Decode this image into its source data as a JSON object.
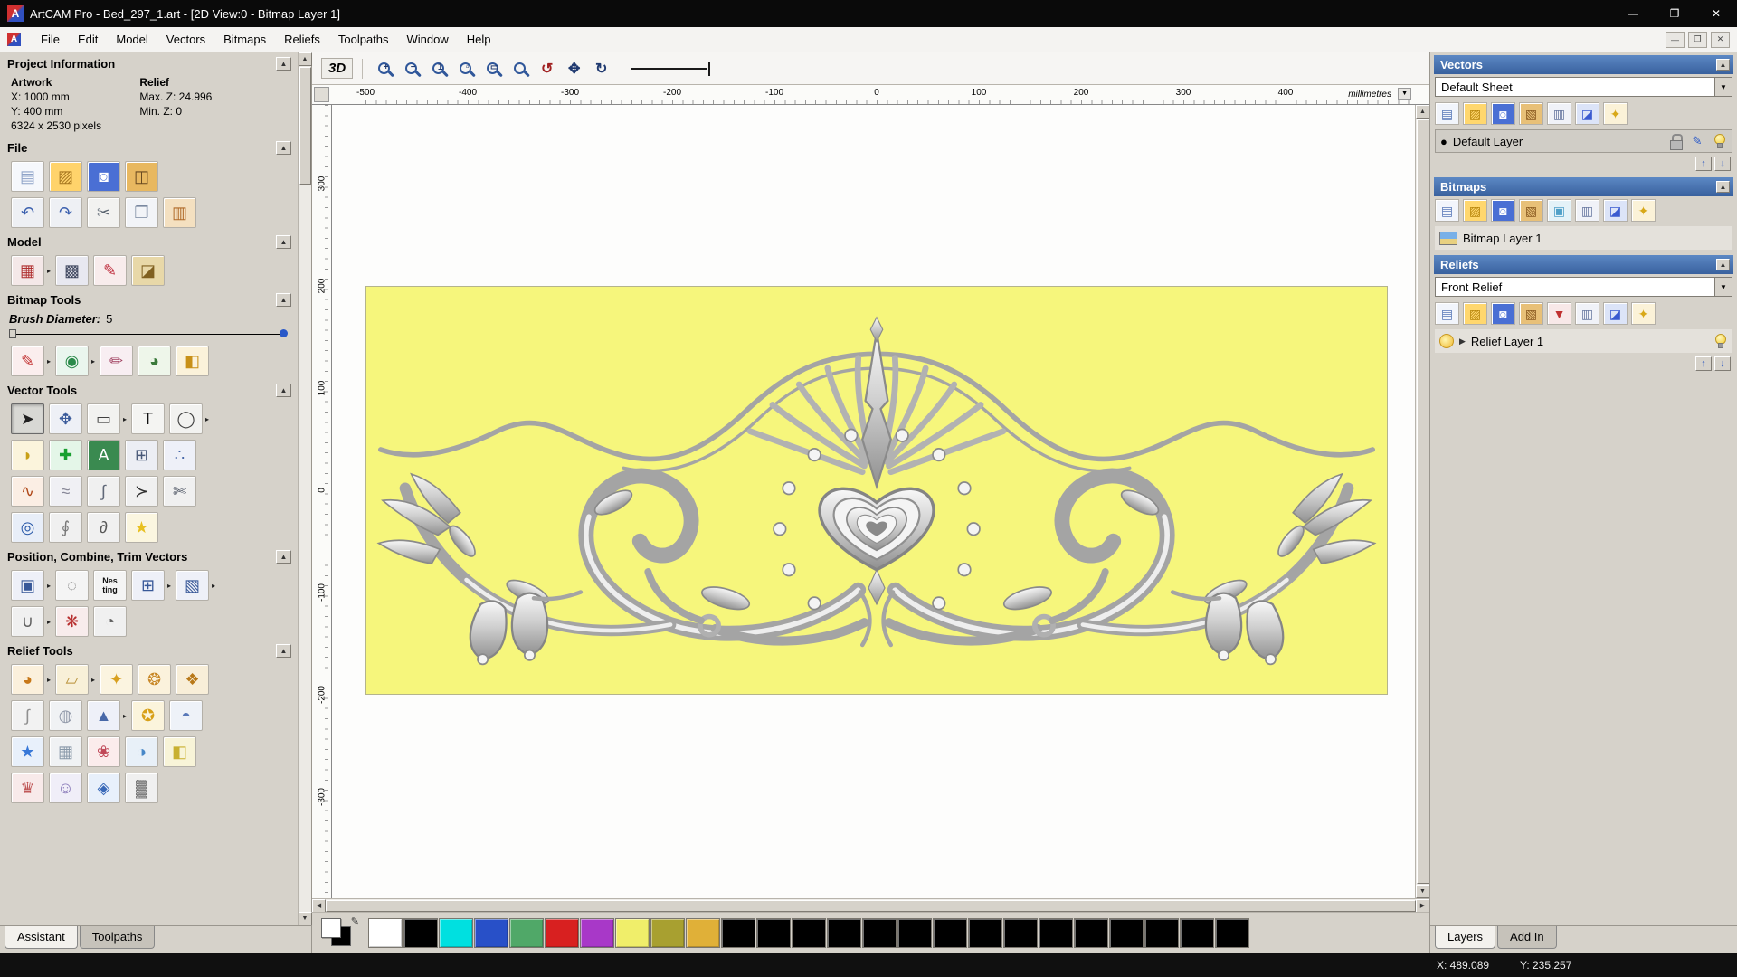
{
  "window": {
    "title": "ArtCAM Pro - Bed_297_1.art - [2D View:0 - Bitmap Layer 1]",
    "logo_letter": "A",
    "buttons": {
      "minimize": "—",
      "restore": "❐",
      "close": "✕"
    },
    "mdi": {
      "minimize": "—",
      "restore": "❐",
      "close": "✕"
    }
  },
  "icons": {
    "rollup": "▲",
    "dropdown": "▼",
    "up_arrow": "↑",
    "down_arrow": "↓",
    "expander": "▶",
    "flyout": "▸",
    "scroll_up": "▲",
    "scroll_down": "▼",
    "scroll_left": "◀",
    "scroll_right": "▶",
    "layer_dot": "●",
    "pencil": "✎"
  },
  "menu": {
    "items": [
      "File",
      "Edit",
      "Model",
      "Vectors",
      "Bitmaps",
      "Reliefs",
      "Toolpaths",
      "Window",
      "Help"
    ]
  },
  "toolbar": {
    "view3d_label": "3D",
    "zoom_buttons": [
      {
        "n": "zoom-in-icon",
        "g": "+"
      },
      {
        "n": "zoom-out-icon",
        "g": "−"
      },
      {
        "n": "zoom-1to1-icon",
        "g": "1"
      },
      {
        "n": "zoom-objects-icon",
        "g": "▫"
      },
      {
        "n": "zoom-page-icon",
        "g": "▭"
      },
      {
        "n": "zoom-window-icon",
        "g": ""
      }
    ],
    "view_buttons": [
      {
        "n": "zoom-previous-icon",
        "g": "↺",
        "fg": "#a02020"
      },
      {
        "n": "pan-view-icon",
        "g": "✥",
        "fg": "#203a70"
      },
      {
        "n": "refresh-view-icon",
        "g": "↻",
        "fg": "#203a70"
      }
    ]
  },
  "assistant": {
    "project_info": {
      "title": "Project Information",
      "artwork_label": "Artwork",
      "relief_label": "Relief",
      "x": "X: 1000 mm",
      "y": "Y: 400 mm",
      "pixels": "6324 x 2530 pixels",
      "max_z": "Max. Z: 24.996",
      "min_z": "Min. Z: 0"
    },
    "sections": [
      {
        "title": "File",
        "rows": [
          [
            {
              "n": "new-model-icon",
              "g": "▤",
              "fg": "#8fa3c8",
              "bg": "#f6f8fc"
            },
            {
              "n": "open-model-icon",
              "g": "▨",
              "fg": "#a87820",
              "bg": "#ffd36b"
            },
            {
              "n": "save-model-icon",
              "g": "◙",
              "fg": "#ffffff",
              "bg": "#4a6fd4"
            },
            {
              "n": "export-model-icon",
              "g": "◫",
              "fg": "#6a4a20",
              "bg": "#e8b860"
            }
          ],
          [
            {
              "n": "undo-icon",
              "g": "↶",
              "fg": "#3a5fae",
              "bg": "#eef0f4"
            },
            {
              "n": "redo-icon",
              "g": "↷",
              "fg": "#3a5fae",
              "bg": "#eef0f4"
            },
            {
              "n": "cut-icon",
              "g": "✂",
              "fg": "#5a6470",
              "bg": "#f2f2f0"
            },
            {
              "n": "copy-icon",
              "g": "❐",
              "fg": "#7a88a0",
              "bg": "#f2f4f8"
            },
            {
              "n": "paste-icon",
              "g": "▥",
              "fg": "#b06a28",
              "bg": "#f4e0c0"
            }
          ]
        ]
      },
      {
        "title": "Model",
        "rows": [
          [
            {
              "n": "set-model-size-icon",
              "g": "▦",
              "fg": "#b03030",
              "bg": "#f4e8e8",
              "fly": true
            },
            {
              "n": "model-lighting-icon",
              "g": "▩",
              "fg": "#404860",
              "bg": "#e8e8f0"
            },
            {
              "n": "model-notes-icon",
              "g": "✎",
              "fg": "#c03040",
              "bg": "#f8ecec"
            },
            {
              "n": "model-preview-icon",
              "g": "◪",
              "fg": "#806020",
              "bg": "#e8d8a8"
            }
          ]
        ]
      },
      {
        "title": "Bitmap Tools",
        "brush": {
          "label": "Brush Diameter:",
          "value": "5"
        },
        "rows": [
          [
            {
              "n": "paint-icon",
              "g": "✎",
              "fg": "#c23030",
              "bg": "#fbeeee",
              "fly": true
            },
            {
              "n": "paint-selective-icon",
              "g": "◉",
              "fg": "#2a8a4a",
              "bg": "#eaf6ee",
              "fly": true
            },
            {
              "n": "colour-picker-icon",
              "g": "✏",
              "fg": "#a04060",
              "bg": "#f8eef2"
            },
            {
              "n": "edit-colour-palette-icon",
              "g": "◕",
              "fg": "#3a7a3a",
              "bg": "#eef6ea"
            },
            {
              "n": "flood-fill-icon",
              "g": "◧",
              "fg": "#c89018",
              "bg": "#fbf2da"
            }
          ]
        ]
      },
      {
        "title": "Vector Tools",
        "rows": [
          [
            {
              "n": "select-vectors-icon",
              "g": "➤",
              "fg": "#202020",
              "bg": "#d8d8d4",
              "active": true
            },
            {
              "n": "transform-vectors-icon",
              "g": "✥",
              "fg": "#3a5a9a",
              "bg": "#eef0f6"
            },
            {
              "n": "create-rectangle-icon",
              "g": "▭",
              "fg": "#404040",
              "bg": "#f2f2f0",
              "fly": true
            },
            {
              "n": "create-text-icon",
              "g": "T",
              "fg": "#101010",
              "bg": "#f4f4f2"
            },
            {
              "n": "measure-icon",
              "g": "◯",
              "fg": "#404040",
              "bg": "#f2f2f0",
              "fly": true
            }
          ],
          [
            {
              "n": "offset-vector-icon",
              "g": "◗",
              "fg": "#c8a018",
              "bg": "#fbf4dc"
            },
            {
              "n": "node-editing-icon",
              "g": "✚",
              "fg": "#18a030",
              "bg": "#e4f6e8"
            },
            {
              "n": "vector-text-table-icon",
              "g": "A",
              "fg": "#ffffff",
              "bg": "#3a8a50"
            },
            {
              "n": "paste-along-curve-icon",
              "g": "⊞",
              "fg": "#485878",
              "bg": "#eceef4"
            },
            {
              "n": "block-array-copy-icon",
              "g": "∴",
              "fg": "#4868a8",
              "bg": "#eef0f8"
            }
          ],
          [
            {
              "n": "create-polyline-icon",
              "g": "∿",
              "fg": "#b04818",
              "bg": "#fbeee4"
            },
            {
              "n": "smooth-polyline-icon",
              "g": "≈",
              "fg": "#888898",
              "bg": "#f0f0f4"
            },
            {
              "n": "fit-curve-icon",
              "g": "∫",
              "fg": "#606878",
              "bg": "#f0f0f0"
            },
            {
              "n": "create-arc-icon",
              "g": "≻",
              "fg": "#303030",
              "bg": "#f0f0f0"
            },
            {
              "n": "trim-vectors-icon",
              "g": "✄",
              "fg": "#404858",
              "bg": "#f0f0f0"
            }
          ],
          [
            {
              "n": "wrap-vectors-icon",
              "g": "◎",
              "fg": "#2858a8",
              "bg": "#e8eef8"
            },
            {
              "n": "fillet-icon",
              "g": "∮",
              "fg": "#787878",
              "bg": "#f0f0f0"
            },
            {
              "n": "distort-vectors-icon",
              "g": "∂",
              "fg": "#585858",
              "bg": "#f0f0f0"
            },
            {
              "n": "create-star-icon",
              "g": "★",
              "fg": "#e8c020",
              "bg": "#fbf6e0"
            }
          ]
        ]
      },
      {
        "title": "Position, Combine, Trim Vectors",
        "rows": [
          [
            {
              "n": "position-vectors-icon",
              "g": "▣",
              "fg": "#385898",
              "bg": "#eef0f8",
              "fly": true
            },
            {
              "n": "rotate-copies-icon",
              "g": "◌",
              "fg": "#787878",
              "bg": "#f4f4f4"
            },
            {
              "n": "nesting-icon",
              "g": "Nes\nting",
              "fg": "#101010",
              "bg": "#f4f4f4",
              "txt": true
            },
            {
              "n": "align-vectors-icon",
              "g": "⊞",
              "fg": "#385898",
              "bg": "#eef0f8",
              "fly": true
            },
            {
              "n": "group-vectors-icon",
              "g": "▧",
              "fg": "#385898",
              "bg": "#eef0f8",
              "fly": true
            }
          ],
          [
            {
              "n": "join-vectors-icon",
              "g": "∪",
              "fg": "#606060",
              "bg": "#f0f0f0",
              "fly": true
            },
            {
              "n": "weld-vectors-icon",
              "g": "❋",
              "fg": "#b83030",
              "bg": "#f8ecec"
            },
            {
              "n": "create-spiral-icon",
              "g": "◔",
              "fg": "#606060",
              "bg": "#f0f0f0"
            }
          ]
        ]
      },
      {
        "title": "Relief Tools",
        "rows": [
          [
            {
              "n": "shape-editor-icon",
              "g": "◕",
              "fg": "#c87818",
              "bg": "#fbf0dc",
              "fly": true
            },
            {
              "n": "smooth-relief-icon",
              "g": "▱",
              "fg": "#b89038",
              "bg": "#f8f0d8",
              "fly": true
            },
            {
              "n": "sculpting-icon",
              "g": "✦",
              "fg": "#d8a020",
              "bg": "#fbf4e0"
            },
            {
              "n": "texture-relief-icon",
              "g": "❂",
              "fg": "#c88828",
              "bg": "#fbf2dc"
            },
            {
              "n": "two-rail-sweep-icon",
              "g": "❖",
              "fg": "#b87818",
              "bg": "#f8eed8"
            }
          ],
          [
            {
              "n": "extrude-icon",
              "g": "∫",
              "fg": "#909090",
              "bg": "#f2f2f2"
            },
            {
              "n": "spin-icon",
              "g": "◍",
              "fg": "#9098a8",
              "bg": "#f0f2f4"
            },
            {
              "n": "turn-icon",
              "g": "▲",
              "fg": "#4868a8",
              "bg": "#eef0f8",
              "fly": true
            },
            {
              "n": "isolines-icon",
              "g": "✪",
              "fg": "#d8a018",
              "bg": "#fbf4dc"
            },
            {
              "n": "constant-height-icon",
              "g": "◓",
              "fg": "#5878b8",
              "bg": "#eef2f8"
            }
          ],
          [
            {
              "n": "star-relief-icon",
              "g": "★",
              "fg": "#3878d8",
              "bg": "#e8f0fb"
            },
            {
              "n": "weave-relief-icon",
              "g": "▦",
              "fg": "#8898a8",
              "bg": "#f0f2f4"
            },
            {
              "n": "flower-relief-icon",
              "g": "❀",
              "fg": "#c04858",
              "bg": "#fbecec"
            },
            {
              "n": "mirror-relief-icon",
              "g": "◑",
              "fg": "#4888c8",
              "bg": "#e8f0f8"
            },
            {
              "n": "offset-relief-icon",
              "g": "◧",
              "fg": "#c8b030",
              "bg": "#f8f4d8"
            }
          ],
          [
            {
              "n": "clipart-icon",
              "g": "♛",
              "fg": "#c05858",
              "bg": "#f8eaea"
            },
            {
              "n": "face-wizard-icon",
              "g": "☺",
              "fg": "#8878b8",
              "bg": "#f0eef8"
            },
            {
              "n": "relief-layer-icon",
              "g": "◈",
              "fg": "#3868b8",
              "bg": "#e8f0fb"
            },
            {
              "n": "greyscale-icon",
              "g": "▓",
              "fg": "#787878",
              "bg": "#f0f0f0"
            }
          ]
        ]
      }
    ],
    "tabs": [
      {
        "label": "Assistant",
        "active": true
      },
      {
        "label": "Toolpaths",
        "active": false
      }
    ]
  },
  "canvas": {
    "ruler_h": [
      "-500",
      "-400",
      "-300",
      "-200",
      "-100",
      "0",
      "100",
      "200",
      "300",
      "400"
    ],
    "ruler_v": [
      "300",
      "200",
      "100",
      "0",
      "-100",
      "-200",
      "-300"
    ],
    "units": "millimetres"
  },
  "palette": {
    "colors": [
      "#ffffff",
      "#000000",
      "#00e0e0",
      "#2850c8",
      "#50a868",
      "#d82020",
      "#a838c8",
      "#f0ee6a",
      "#a8a030",
      "#e0b038",
      "#000000",
      "#000000",
      "#000000",
      "#000000",
      "#000000",
      "#000000",
      "#000000",
      "#000000",
      "#000000",
      "#000000",
      "#000000",
      "#000000",
      "#000000",
      "#000000",
      "#000000"
    ]
  },
  "right_panel": {
    "vectors": {
      "title": "Vectors",
      "sheet_value": "Default Sheet",
      "layer_name": "Default Layer",
      "tools": [
        {
          "n": "vectors-new-sheet-icon",
          "g": "▤",
          "fg": "#5878b8",
          "bg": "#f2f5fb"
        },
        {
          "n": "vectors-open-icon",
          "g": "▨",
          "fg": "#b8860b",
          "bg": "#ffd76e"
        },
        {
          "n": "vectors-save-icon",
          "g": "◙",
          "fg": "#ffffff",
          "bg": "#4a6fd4"
        },
        {
          "n": "vectors-import-icon",
          "g": "▧",
          "fg": "#8a5a20",
          "bg": "#e8c078"
        },
        {
          "n": "vectors-new-layer-icon",
          "g": "▥",
          "fg": "#6878a0",
          "bg": "#f0f2f8"
        },
        {
          "n": "vectors-delete-layer-icon",
          "g": "◪",
          "fg": "#3a5ad0",
          "bg": "#dce4f8"
        },
        {
          "n": "vectors-merge-layers-icon",
          "g": "✦",
          "fg": "#d8a818",
          "bg": "#fbf2d8"
        }
      ]
    },
    "bitmaps": {
      "title": "Bitmaps",
      "layer_name": "Bitmap Layer 1",
      "tools": [
        {
          "n": "bitmaps-new-icon",
          "g": "▤",
          "fg": "#5878b8",
          "bg": "#f2f5fb"
        },
        {
          "n": "bitmaps-open-icon",
          "g": "▨",
          "fg": "#b8860b",
          "bg": "#ffd76e"
        },
        {
          "n": "bitmaps-save-icon",
          "g": "◙",
          "fg": "#ffffff",
          "bg": "#4a6fd4"
        },
        {
          "n": "bitmaps-import-icon",
          "g": "▧",
          "fg": "#8a5a20",
          "bg": "#e8c078"
        },
        {
          "n": "bitmaps-combine-icon",
          "g": "▣",
          "fg": "#50a0c8",
          "bg": "#e4f2f8"
        },
        {
          "n": "bitmaps-new-layer-icon",
          "g": "▥",
          "fg": "#6878a0",
          "bg": "#f0f2f8"
        },
        {
          "n": "bitmaps-delete-layer-icon",
          "g": "◪",
          "fg": "#3a5ad0",
          "bg": "#dce4f8"
        },
        {
          "n": "bitmaps-merge-layers-icon",
          "g": "✦",
          "fg": "#d8a818",
          "bg": "#fbf2d8"
        }
      ]
    },
    "reliefs": {
      "title": "Reliefs",
      "relief_value": "Front Relief",
      "layer_name": "Relief Layer 1",
      "tools": [
        {
          "n": "reliefs-new-icon",
          "g": "▤",
          "fg": "#5878b8",
          "bg": "#f2f5fb"
        },
        {
          "n": "reliefs-open-icon",
          "g": "▨",
          "fg": "#b8860b",
          "bg": "#ffd76e"
        },
        {
          "n": "reliefs-save-icon",
          "g": "◙",
          "fg": "#ffffff",
          "bg": "#4a6fd4"
        },
        {
          "n": "reliefs-import-icon",
          "g": "▧",
          "fg": "#8a5a20",
          "bg": "#e8c078"
        },
        {
          "n": "reliefs-transfer-icon",
          "g": "▼",
          "fg": "#c03030",
          "bg": "#f8e8e8"
        },
        {
          "n": "reliefs-new-layer-icon",
          "g": "▥",
          "fg": "#6878a0",
          "bg": "#f0f2f8"
        },
        {
          "n": "reliefs-delete-layer-icon",
          "g": "◪",
          "fg": "#3a5ad0",
          "bg": "#dce4f8"
        },
        {
          "n": "reliefs-merge-layers-icon",
          "g": "✦",
          "fg": "#d8a818",
          "bg": "#fbf2d8"
        }
      ]
    },
    "tabs": [
      {
        "label": "Layers",
        "active": true
      },
      {
        "label": "Add In",
        "active": false
      }
    ]
  },
  "status": {
    "x": "X: 489.089",
    "y": "Y: 235.257"
  }
}
